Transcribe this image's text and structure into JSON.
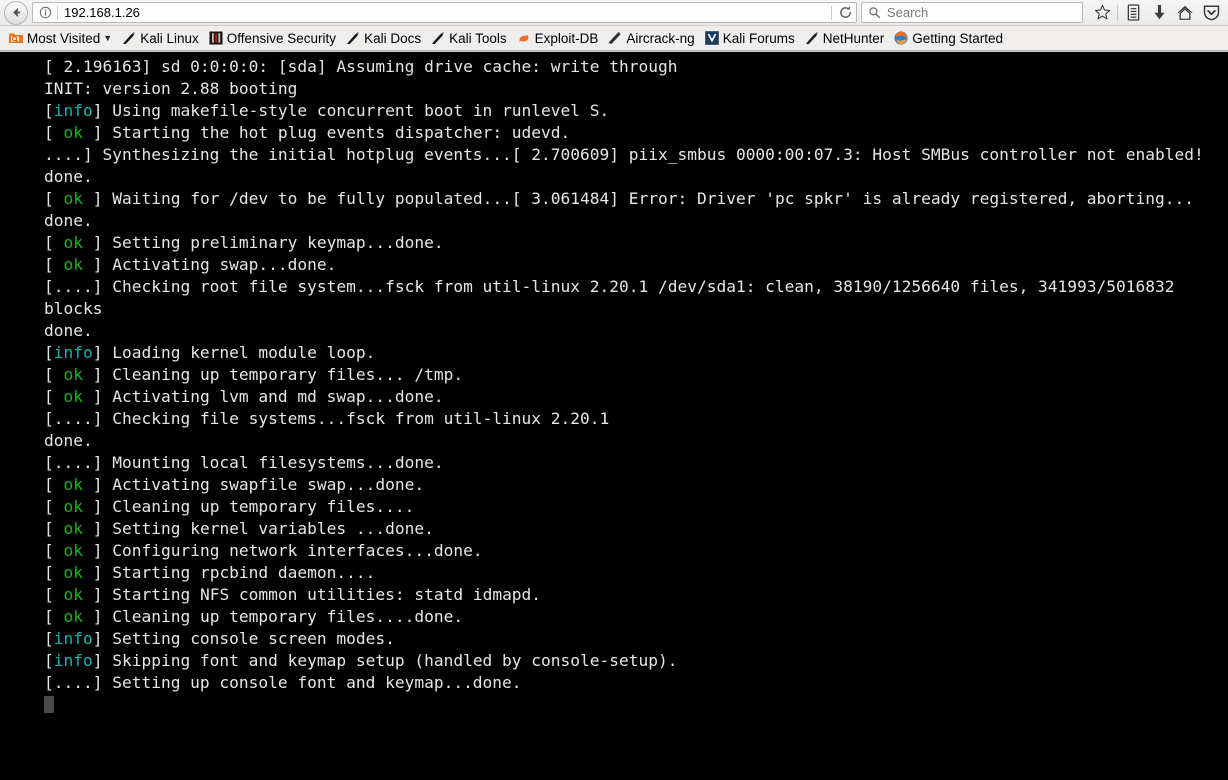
{
  "browser": {
    "back_button": "back-arrow",
    "identity_icon": "info-circle-icon",
    "url": "192.168.1.26",
    "reload_icon": "reload-icon",
    "search": {
      "icon": "search-icon",
      "placeholder": "Search",
      "value": ""
    },
    "toolbar_icons": [
      {
        "name": "bookmark-star-icon",
        "glyph": "star"
      },
      {
        "name": "library-icon",
        "glyph": "library"
      },
      {
        "name": "downloads-icon",
        "glyph": "download"
      },
      {
        "name": "home-icon",
        "glyph": "home"
      },
      {
        "name": "pocket-shield-icon",
        "glyph": "shield"
      }
    ]
  },
  "bookmarks": [
    {
      "label": "Most Visited",
      "icon": "most-visited-folder-icon",
      "has_caret": true
    },
    {
      "label": "Kali Linux",
      "icon": "kali-dragon-icon",
      "has_caret": false
    },
    {
      "label": "Offensive Security",
      "icon": "offensive-security-icon",
      "has_caret": false
    },
    {
      "label": "Kali Docs",
      "icon": "kali-dragon-icon",
      "has_caret": false
    },
    {
      "label": "Kali Tools",
      "icon": "kali-dragon-icon",
      "has_caret": false
    },
    {
      "label": "Exploit-DB",
      "icon": "exploit-db-icon",
      "has_caret": false
    },
    {
      "label": "Aircrack-ng",
      "icon": "aircrack-ng-icon",
      "has_caret": false
    },
    {
      "label": "Kali Forums",
      "icon": "kali-forums-icon",
      "has_caret": false
    },
    {
      "label": "NetHunter",
      "icon": "kali-dragon-icon",
      "has_caret": false
    },
    {
      "label": "Getting Started",
      "icon": "firefox-icon",
      "has_caret": false
    }
  ],
  "console": {
    "colors": {
      "background": "#000000",
      "text": "#e6e6e6",
      "ok": "#18b218",
      "info": "#18b2b2",
      "cursor": "#4a4a4a"
    },
    "lines": [
      {
        "segments": [
          {
            "text": "[ 2.196163] sd 0:0:0:0: [sda] Assuming drive cache: write through"
          }
        ]
      },
      {
        "segments": [
          {
            "text": "INIT: version 2.88 booting"
          }
        ]
      },
      {
        "segments": [
          {
            "text": "["
          },
          {
            "text": "info",
            "style": "info"
          },
          {
            "text": "] Using makefile-style concurrent boot in runlevel S."
          }
        ]
      },
      {
        "segments": [
          {
            "text": "[ "
          },
          {
            "text": "ok",
            "style": "ok"
          },
          {
            "text": " ] Starting the hot plug events dispatcher: udevd."
          }
        ]
      },
      {
        "segments": [
          {
            "text": "....] Synthesizing the initial hotplug events...[ 2.700609] piix_smbus 0000:00:07.3: Host SMBus controller not enabled!"
          }
        ]
      },
      {
        "segments": [
          {
            "text": "done."
          }
        ]
      },
      {
        "segments": [
          {
            "text": "[ "
          },
          {
            "text": "ok",
            "style": "ok"
          },
          {
            "text": " ] Waiting for /dev to be fully populated...[ 3.061484] Error: Driver 'pc spkr' is already registered, aborting..."
          }
        ]
      },
      {
        "segments": [
          {
            "text": "done."
          }
        ]
      },
      {
        "segments": [
          {
            "text": "[ "
          },
          {
            "text": "ok",
            "style": "ok"
          },
          {
            "text": " ] Setting preliminary keymap...done."
          }
        ]
      },
      {
        "segments": [
          {
            "text": "[ "
          },
          {
            "text": "ok",
            "style": "ok"
          },
          {
            "text": " ] Activating swap...done."
          }
        ]
      },
      {
        "segments": [
          {
            "text": "[....] Checking root file system...fsck from util-linux 2.20.1 /dev/sda1: clean, 38190/1256640 files, 341993/5016832 blocks"
          }
        ]
      },
      {
        "segments": [
          {
            "text": "done."
          }
        ]
      },
      {
        "segments": [
          {
            "text": "["
          },
          {
            "text": "info",
            "style": "info"
          },
          {
            "text": "] Loading kernel module loop."
          }
        ]
      },
      {
        "segments": [
          {
            "text": "[ "
          },
          {
            "text": "ok",
            "style": "ok"
          },
          {
            "text": " ] Cleaning up temporary files... /tmp."
          }
        ]
      },
      {
        "segments": [
          {
            "text": "[ "
          },
          {
            "text": "ok",
            "style": "ok"
          },
          {
            "text": " ] Activating lvm and md swap...done."
          }
        ]
      },
      {
        "segments": [
          {
            "text": "[....] Checking file systems...fsck from util-linux 2.20.1"
          }
        ]
      },
      {
        "segments": [
          {
            "text": "done."
          }
        ]
      },
      {
        "segments": [
          {
            "text": "[....] Mounting local filesystems...done."
          }
        ]
      },
      {
        "segments": [
          {
            "text": "[ "
          },
          {
            "text": "ok",
            "style": "ok"
          },
          {
            "text": " ] Activating swapfile swap...done."
          }
        ]
      },
      {
        "segments": [
          {
            "text": "[ "
          },
          {
            "text": "ok",
            "style": "ok"
          },
          {
            "text": " ] Cleaning up temporary files...."
          }
        ]
      },
      {
        "segments": [
          {
            "text": "[ "
          },
          {
            "text": "ok",
            "style": "ok"
          },
          {
            "text": " ] Setting kernel variables ...done."
          }
        ]
      },
      {
        "segments": [
          {
            "text": "[ "
          },
          {
            "text": "ok",
            "style": "ok"
          },
          {
            "text": " ] Configuring network interfaces...done."
          }
        ]
      },
      {
        "segments": [
          {
            "text": "[ "
          },
          {
            "text": "ok",
            "style": "ok"
          },
          {
            "text": " ] Starting rpcbind daemon...."
          }
        ]
      },
      {
        "segments": [
          {
            "text": "[ "
          },
          {
            "text": "ok",
            "style": "ok"
          },
          {
            "text": " ] Starting NFS common utilities: statd idmapd."
          }
        ]
      },
      {
        "segments": [
          {
            "text": "[ "
          },
          {
            "text": "ok",
            "style": "ok"
          },
          {
            "text": " ] Cleaning up temporary files....done."
          }
        ]
      },
      {
        "segments": [
          {
            "text": "["
          },
          {
            "text": "info",
            "style": "info"
          },
          {
            "text": "] Setting console screen modes."
          }
        ]
      },
      {
        "segments": [
          {
            "text": "["
          },
          {
            "text": "info",
            "style": "info"
          },
          {
            "text": "] Skipping font and keymap setup (handled by console-setup)."
          }
        ]
      },
      {
        "segments": [
          {
            "text": "[....] Setting up console font and keymap...done."
          }
        ]
      },
      {
        "segments": [
          {
            "text": "",
            "cursor": true
          }
        ]
      }
    ]
  }
}
